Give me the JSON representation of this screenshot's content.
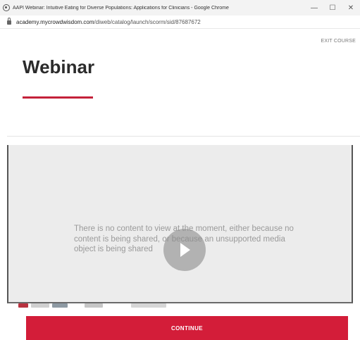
{
  "window": {
    "title": "AAPI Webinar: Intuitive Eating for Diverse Populations: Applications for Clinicians - Google Chrome",
    "minimize": "—",
    "maximize": "☐",
    "close": "✕"
  },
  "address": {
    "domain": "academy.mycrowdwisdom.com",
    "path": "/diweb/catalog/launch/scorm/sid/87687672"
  },
  "header": {
    "exit_label": "EXIT COURSE",
    "title": "Webinar"
  },
  "video": {
    "message": "There is no content to view at the moment, either because no content is being shared, or because an unsupported media object is being shared"
  },
  "footer": {
    "continue_label": "CONTINUE"
  },
  "colors": {
    "accent": "#c4213a",
    "button": "#d31d39"
  },
  "icons": [
    "chrome-icon",
    "lock-icon",
    "play-icon"
  ]
}
